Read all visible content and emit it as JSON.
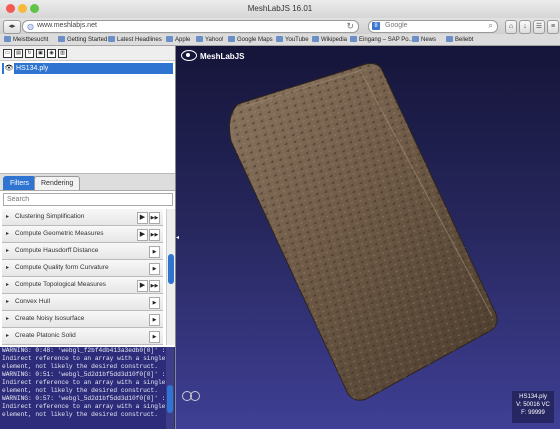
{
  "browser": {
    "window_title": "MeshLabJS 16.01",
    "url": "www.meshlabjs.net",
    "search_placeholder": "Google",
    "bookmarks": [
      {
        "label": "Meistbesucht"
      },
      {
        "label": "Getting Started"
      },
      {
        "label": "Latest Headlines"
      },
      {
        "label": "Apple"
      },
      {
        "label": "Yahoo!"
      },
      {
        "label": "Google Maps"
      },
      {
        "label": "YouTube"
      },
      {
        "label": "Wikipedia"
      },
      {
        "label": "Eingang – SAP Po..."
      },
      {
        "label": "News"
      },
      {
        "label": "Beliebt"
      }
    ]
  },
  "layers": [
    {
      "name": "HS134.ply",
      "visible": true
    }
  ],
  "tabs": [
    {
      "label": "Filters",
      "active": true
    },
    {
      "label": "Rendering",
      "active": false
    }
  ],
  "filter_search_placeholder": "Search",
  "filters": [
    {
      "label": "Clustering Simplification",
      "buttons": 2
    },
    {
      "label": "Compute Geometric Measures",
      "buttons": 2
    },
    {
      "label": "Compute Hausdorff Distance",
      "buttons": 1
    },
    {
      "label": "Compute Quality form Curvature",
      "buttons": 1
    },
    {
      "label": "Compute Topological Measures",
      "buttons": 2
    },
    {
      "label": "Convex Hull",
      "buttons": 1
    },
    {
      "label": "Create Noisy Isosurface",
      "buttons": 1
    },
    {
      "label": "Create Platonic Solid",
      "buttons": 1
    }
  ],
  "console_lines": [
    "WARNING: 0:48: 'webgl_f2bf4db413a3edb0[0]' :",
    "Indirect reference to an array with a single",
    "element, not likely the desired construct.",
    "WARNING: 0:51: 'webgl_5d2d1bf5dd3d10f0[0]' :",
    "Indirect reference to an array with a single",
    "element, not likely the desired construct.",
    "WARNING: 0:57: 'webgl_5d2d1bf5dd3d10f0[0]' :",
    "Indirect reference to an array with a single",
    "element, not likely the desired construct."
  ],
  "viewer": {
    "logo_text": "MeshLabJS",
    "info_name": "HS134.ply",
    "info_vertices": "V: 50016 VC",
    "info_faces": "F: 99999"
  },
  "colors": {
    "accent": "#2f74d0",
    "console_bg": "#2c2c7a",
    "viewer_top": "#15153a",
    "viewer_bottom": "#3f3f95",
    "tablet": "#6e5a46"
  }
}
